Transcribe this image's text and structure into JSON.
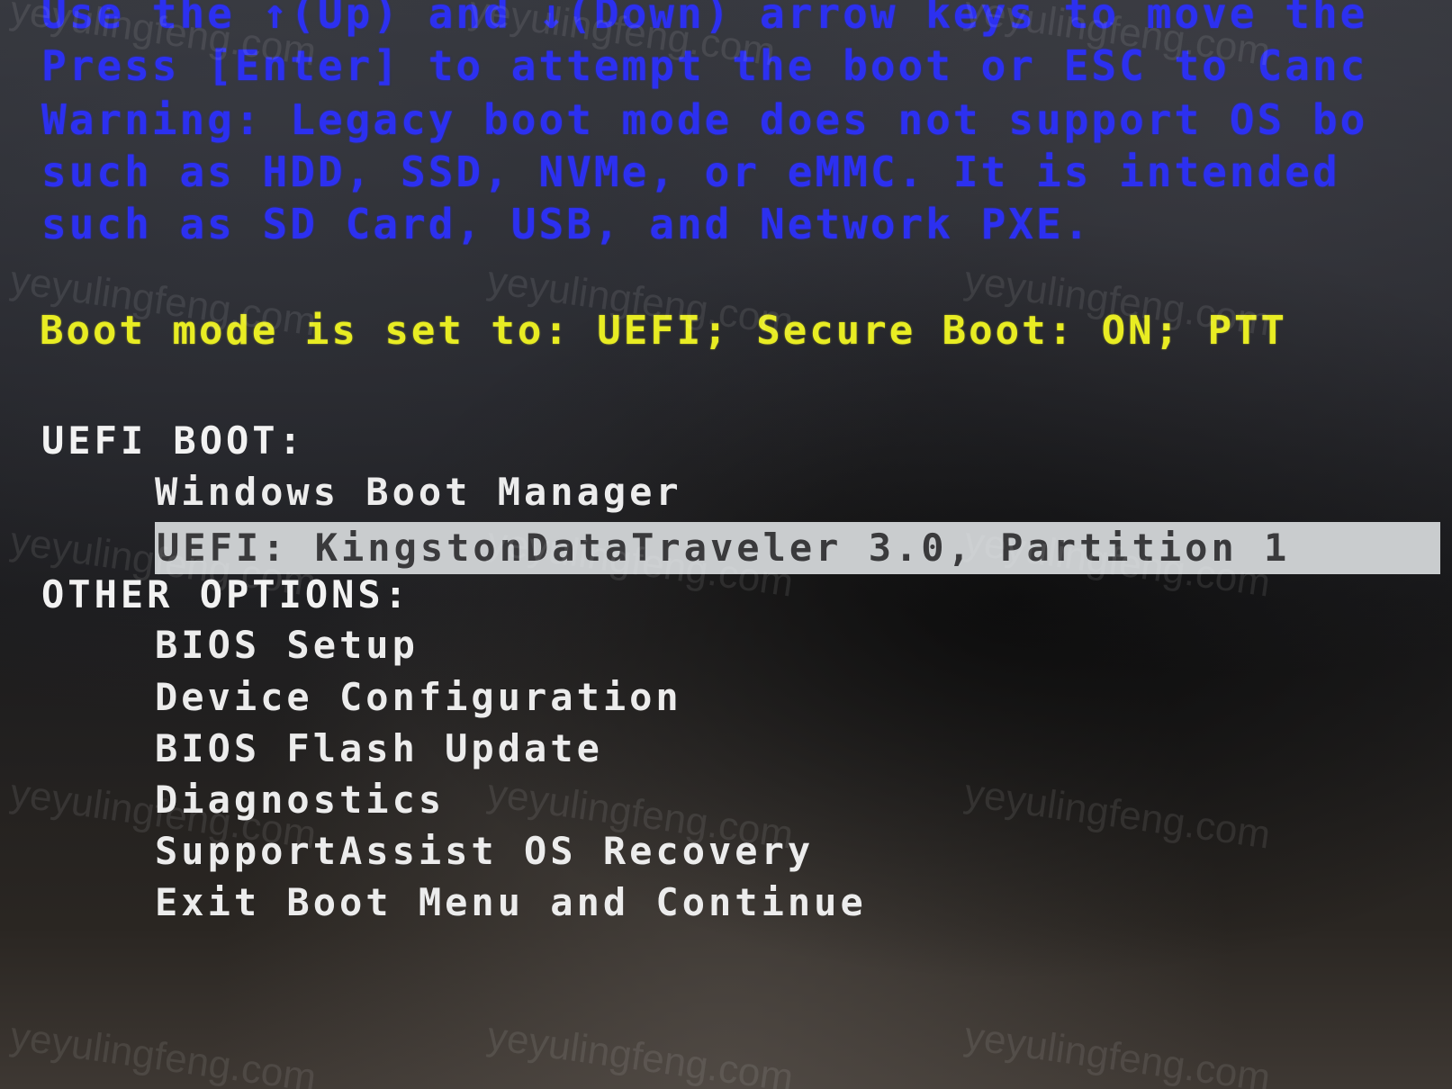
{
  "instructions": [
    "Use the ↑(Up) and ↓(Down) arrow keys to move the",
    "Press [Enter] to attempt the boot or ESC to Canc",
    "Warning: Legacy boot mode does not support OS bo",
    "such as HDD, SSD, NVMe, or eMMC. It is intended",
    "such as SD Card, USB, and Network PXE."
  ],
  "status_line": "Boot mode is set to: UEFI; Secure Boot: ON; PTT",
  "uefi_boot": {
    "heading": "UEFI BOOT:",
    "items": [
      "Windows Boot Manager",
      "UEFI: KingstonDataTraveler 3.0, Partition 1"
    ]
  },
  "other_options": {
    "heading": "OTHER OPTIONS:",
    "items": [
      "BIOS Setup",
      "Device Configuration",
      "BIOS Flash Update",
      "Diagnostics",
      "SupportAssist OS Recovery",
      "Exit Boot Menu and Continue"
    ]
  },
  "watermark": "yeyulingfeng.com",
  "colors": {
    "instruction_text": "#2c30f0",
    "status_text": "#e8ec23",
    "menu_text": "#ececec",
    "selection_bg": "#c9ccce"
  }
}
